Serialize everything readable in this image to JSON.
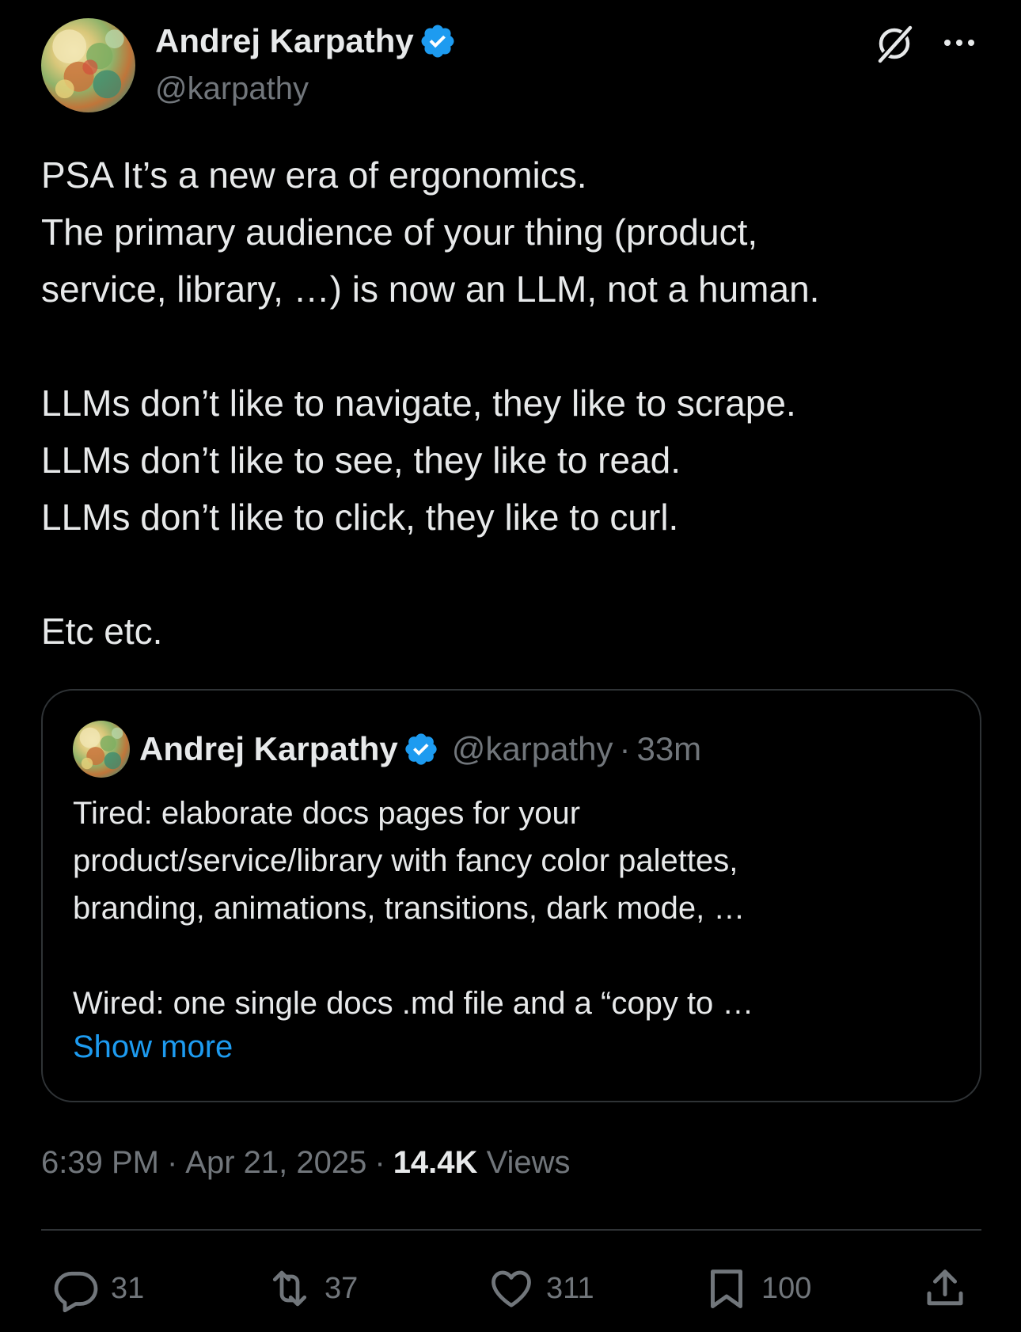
{
  "author": {
    "name": "Andrej Karpathy",
    "handle": "@karpathy",
    "verified": true
  },
  "header_icons": [
    "grok-icon",
    "more-options-icon"
  ],
  "tweet": {
    "lines": [
      "PSA It’s a new era of ergonomics.",
      "The primary audience of your thing (product,",
      "service, library, …) is now an LLM, not a human.",
      "",
      "LLMs don’t like to navigate, they like to scrape.",
      "LLMs don’t like to see, they like to read.",
      "LLMs don’t like to click, they like to curl.",
      "",
      "Etc etc."
    ]
  },
  "quote": {
    "name": "Andrej Karpathy",
    "handle": "@karpathy",
    "separator": "·",
    "time": "33m",
    "lines": [
      "Tired: elaborate docs pages for your",
      "product/service/library with fancy color palettes,",
      "branding, animations, transitions, dark mode, …",
      "",
      "Wired: one single docs .md file and a “copy to …"
    ],
    "show_more": "Show more"
  },
  "meta": {
    "time": "6:39 PM",
    "separator": "·",
    "date": "Apr 21, 2025",
    "views_count": "14.4K",
    "views_label": "Views"
  },
  "actions": {
    "replies": "31",
    "reposts": "37",
    "likes": "311",
    "bookmarks": "100"
  },
  "colors": {
    "background": "#000000",
    "text_primary": "#e7e9ea",
    "text_secondary": "#71767b",
    "accent": "#1d9bf0",
    "border": "#2f3336"
  }
}
